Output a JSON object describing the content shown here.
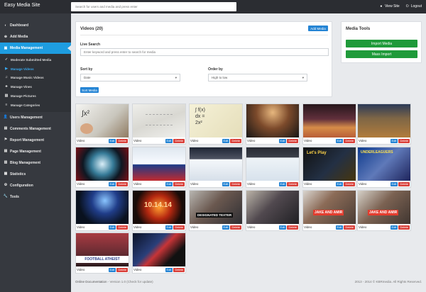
{
  "app": {
    "brand": "Easy Media Site",
    "search_placeholder": "Search for users and media and press enter",
    "view_site": "View Site",
    "logout": "Logout"
  },
  "sidebar": {
    "items": [
      {
        "label": "Dashboard",
        "icon": "dashboard-icon"
      },
      {
        "label": "Add Media",
        "icon": "add-icon"
      },
      {
        "label": "Media Management",
        "icon": "media-icon",
        "active": true
      }
    ],
    "submenu": [
      {
        "label": "Moderate Submitted Media",
        "icon": "check-icon"
      },
      {
        "label": "Manage Videos",
        "icon": "video-icon",
        "active": true
      },
      {
        "label": "Manage Music Videos",
        "icon": "music-icon"
      },
      {
        "label": "Manage Vines",
        "icon": "vine-icon"
      },
      {
        "label": "Manage Pictures",
        "icon": "picture-icon"
      },
      {
        "label": "Manage Categories",
        "icon": "category-icon"
      }
    ],
    "items_after": [
      {
        "label": "Users Management",
        "icon": "user-icon"
      },
      {
        "label": "Comments Management",
        "icon": "comment-icon"
      },
      {
        "label": "Report Management",
        "icon": "report-icon"
      },
      {
        "label": "Page Management",
        "icon": "page-icon"
      },
      {
        "label": "Blog Management",
        "icon": "blog-icon"
      },
      {
        "label": "Statistics",
        "icon": "statistics-icon"
      },
      {
        "label": "Configuration",
        "icon": "configuration-icon"
      },
      {
        "label": "Tools",
        "icon": "tools-icon"
      }
    ]
  },
  "videos_panel": {
    "title": "Videos (20)",
    "add_media": "Add Media",
    "live_search_label": "Live Search",
    "live_search_placeholder": "Enter keyword and press enter to search for media",
    "sort_by_label": "Sort by",
    "sort_by_value": "Date",
    "order_by_label": "Order by",
    "order_by_value": "High to low",
    "sort_button": "Sort Media"
  },
  "media_tools": {
    "title": "Media Tools",
    "import": "Import Media",
    "mass_import": "Mass Import"
  },
  "card_labels": {
    "type": "Video",
    "edit": "Edit",
    "delete": "Delete"
  },
  "videos": [
    {
      "theme": "math-board",
      "caption": ""
    },
    {
      "theme": "white-board",
      "caption": ""
    },
    {
      "theme": "notebook",
      "caption": ""
    },
    {
      "theme": "basketball-dark",
      "caption": ""
    },
    {
      "theme": "basketball-crowd",
      "caption": ""
    },
    {
      "theme": "basketball-court",
      "caption": ""
    },
    {
      "theme": "hockey-goal",
      "caption": ""
    },
    {
      "theme": "hockey-players",
      "caption": ""
    },
    {
      "theme": "hockey-rink",
      "caption": ""
    },
    {
      "theme": "hockey-ice",
      "caption": ""
    },
    {
      "theme": "lets-play",
      "caption": "Let's Play"
    },
    {
      "theme": "underleaguers",
      "caption": "UNDERLEAGUERS"
    },
    {
      "theme": "portal",
      "caption": ""
    },
    {
      "theme": "trailer",
      "caption": "10.14.14"
    },
    {
      "theme": "designated-texter",
      "caption": "DESIGNATED TEXTER"
    },
    {
      "theme": "office",
      "caption": ""
    },
    {
      "theme": "jake-amir",
      "caption": "JAKE AND AMIR"
    },
    {
      "theme": "jake-amir-2",
      "caption": "JAKE AND AMIR"
    },
    {
      "theme": "football-atheist",
      "caption": "FOOTBALL ATHEIST"
    },
    {
      "theme": "avengers",
      "caption": ""
    }
  ],
  "footer": {
    "documentation": "Online Documentation",
    "version": "- Version 1.0 (Check for update)",
    "copyright": "2013 - 2014 © KBRmedia. All Rights Reserved."
  },
  "colors": {
    "topbar": "#2b2d32",
    "sidebar": "#36393f",
    "active": "#1e9de0",
    "edit": "#2484d4",
    "delete": "#d9403a",
    "green": "#1f9a3a"
  }
}
